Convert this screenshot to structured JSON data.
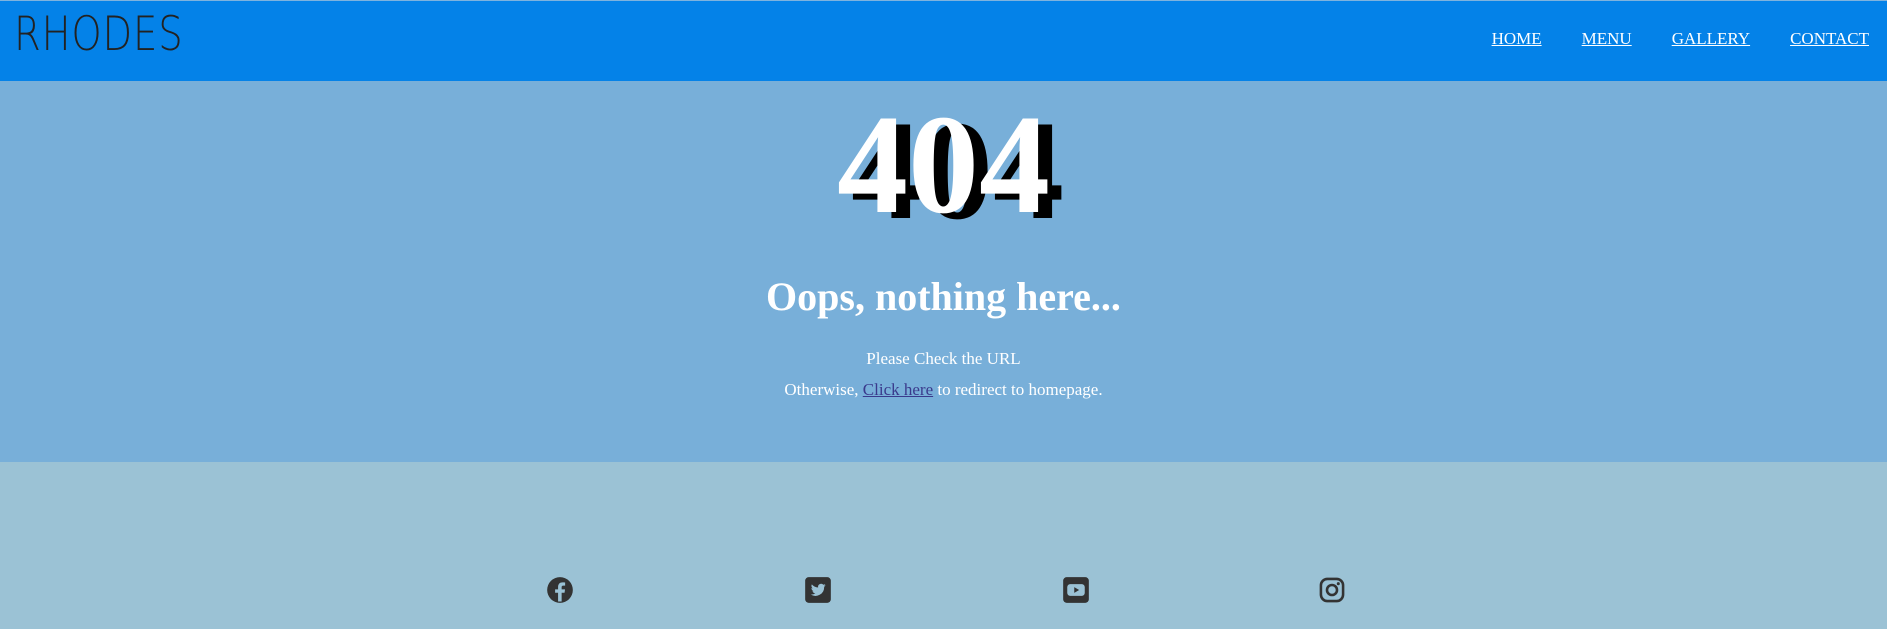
{
  "header": {
    "logo": "RHODES",
    "nav": [
      "HOME",
      "MENU",
      "GALLERY",
      "CONTACT"
    ]
  },
  "error": {
    "code": "404",
    "heading": "Oops, nothing here...",
    "line1": "Please Check the URL",
    "line2_prefix": "Otherwise, ",
    "link": "Click here",
    "line2_suffix": " to redirect to homepage."
  },
  "footer": {
    "social_icons": [
      "facebook-icon",
      "twitter-icon",
      "youtube-icon",
      "instagram-icon"
    ]
  },
  "colors": {
    "navbar": "#0482e8",
    "hero": "#78afd9",
    "footer": "#9bc2d5",
    "icon": "#333333"
  }
}
